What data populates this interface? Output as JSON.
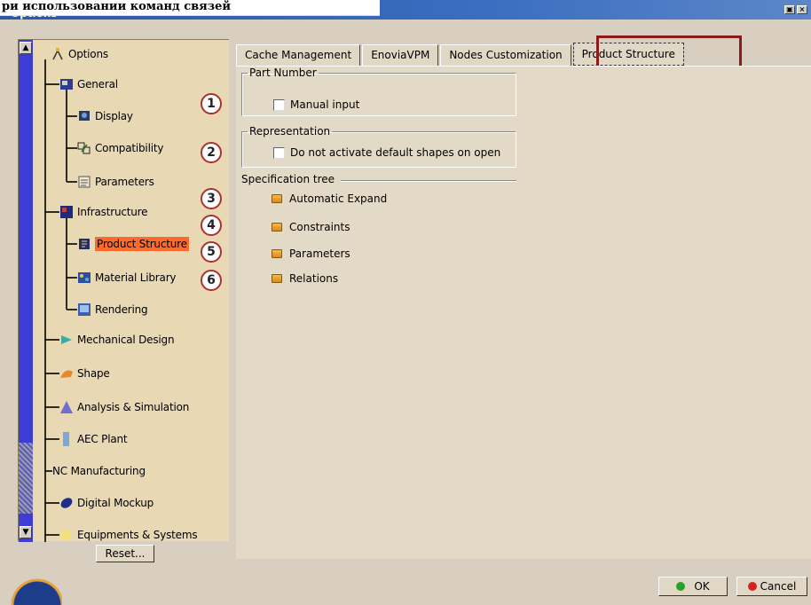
{
  "caption": "ри использовании команд связей",
  "window": {
    "title": "Options"
  },
  "colors": {
    "selected_bg": "#ff6a2a",
    "badge_border": "#a8322e",
    "tab_highlight": "#8b1a1a",
    "ok_dot": "#2aa02a",
    "cancel_dot": "#d42222"
  },
  "tree": {
    "root": "Options",
    "items": [
      {
        "label": "General",
        "icon": "general-icon"
      },
      {
        "label": "Display",
        "icon": "display-icon"
      },
      {
        "label": "Compatibility",
        "icon": "compatibility-icon"
      },
      {
        "label": "Parameters",
        "icon": "parameters-icon"
      },
      {
        "label": "Infrastructure",
        "icon": "infrastructure-icon"
      },
      {
        "label": "Product Structure",
        "icon": "product-structure-icon"
      },
      {
        "label": "Material Library",
        "icon": "material-library-icon"
      },
      {
        "label": "Rendering",
        "icon": "rendering-icon"
      },
      {
        "label": "Mechanical Design",
        "icon": "mechanical-design-icon"
      },
      {
        "label": "Shape",
        "icon": "shape-icon"
      },
      {
        "label": "Analysis & Simulation",
        "icon": "analysis-icon"
      },
      {
        "label": "AEC Plant",
        "icon": "aec-plant-icon"
      },
      {
        "label": "NC Manufacturing",
        "icon": "nc-manufacturing-icon"
      },
      {
        "label": "Digital Mockup",
        "icon": "digital-mockup-icon"
      },
      {
        "label": "Equipments & Systems",
        "icon": "equipments-icon"
      }
    ],
    "reset_label": "Reset..."
  },
  "badges": [
    "1",
    "2",
    "3",
    "4",
    "5",
    "6"
  ],
  "tabs": [
    {
      "label": "Cache Management"
    },
    {
      "label": "EnoviaVPM"
    },
    {
      "label": "Nodes Customization"
    },
    {
      "label": "Product Structure"
    }
  ],
  "part_number": {
    "legend": "Part Number",
    "checkbox_label": "Manual input"
  },
  "representation": {
    "legend": "Representation",
    "checkbox_label": "Do not activate default shapes on open"
  },
  "spec_tree": {
    "title": "Specification tree",
    "items": [
      "Automatic Expand",
      "Constraints",
      "Parameters",
      "Relations"
    ]
  },
  "buttons": {
    "ok": "OK",
    "cancel": "Cancel"
  }
}
